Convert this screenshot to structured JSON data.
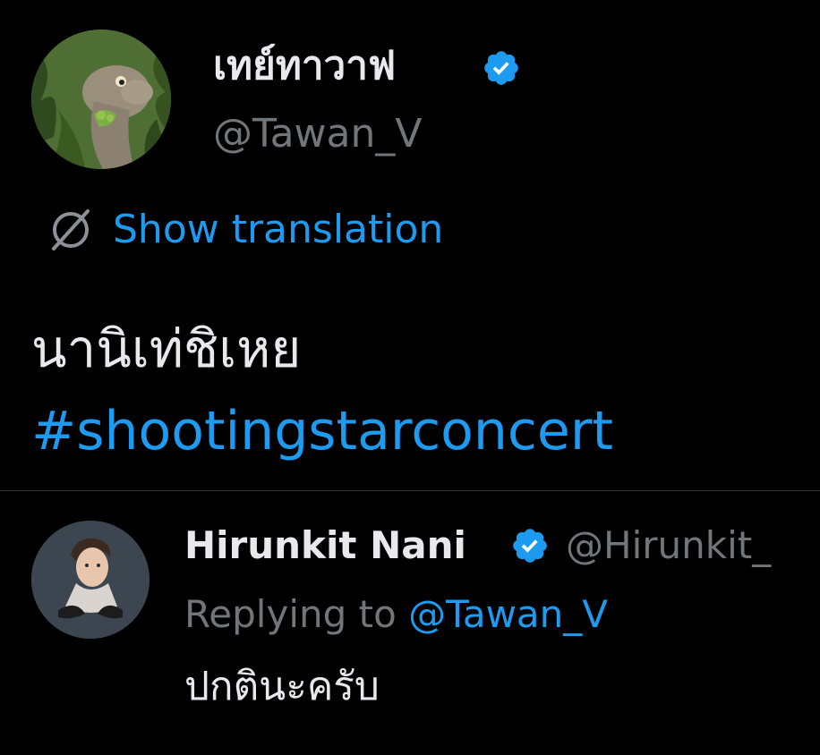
{
  "main_tweet": {
    "author": {
      "display_name": "เทย์ทาวาฟ",
      "handle": "@Tawan_V",
      "verified": true,
      "avatar_icon": "dinosaur-avatar"
    },
    "translate": {
      "icon": "globe-icon",
      "label": "Show translation"
    },
    "text": "นานิเท่ชิเหย",
    "hashtag": "#shootingstarconcert"
  },
  "reply": {
    "author": {
      "display_name": "Hirunkit Nani",
      "handle": "@Hirunkit_",
      "verified": true,
      "avatar_icon": "person-avatar"
    },
    "replying_prefix": "Replying to ",
    "replying_to": "@Tawan_V",
    "text": "ปกตินะครับ"
  },
  "colors": {
    "background": "#000000",
    "text_primary": "#e7e9ea",
    "text_secondary": "#71767b",
    "accent": "#1d9bf0",
    "verified": "#1d9bf0",
    "divider": "#2f3336"
  }
}
